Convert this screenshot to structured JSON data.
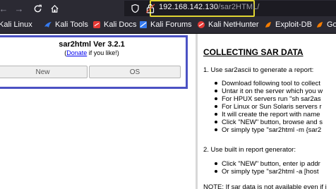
{
  "browser": {
    "url_host": "192.168.142.130",
    "url_path": "/sar2HTML/",
    "bookmarks": [
      {
        "label": "Kali Linux",
        "icon": "kali-icon"
      },
      {
        "label": "Kali Tools",
        "icon": "kali-tools-icon"
      },
      {
        "label": "Kali Docs",
        "icon": "kali-docs-icon"
      },
      {
        "label": "Kali Forums",
        "icon": "kali-forums-icon"
      },
      {
        "label": "Kali NetHunter",
        "icon": "nethunter-icon"
      },
      {
        "label": "Exploit-DB",
        "icon": "exploit-db-icon"
      },
      {
        "label": "Go",
        "icon": "ghdb-icon"
      }
    ]
  },
  "app": {
    "title": "sar2html Ver 3.2.1",
    "donate_prefix": "(",
    "donate_link": "Donate",
    "donate_suffix": " if you like!)",
    "buttons": {
      "new": "New",
      "os": "OS"
    }
  },
  "instructions": {
    "title": "COLLECTING SAR DATA",
    "step1": "1. Use sar2ascii to generate a report:",
    "step1_items": [
      "Download following tool to collect",
      "Untar it on the server which you w",
      "For HPUX servers run \"sh sar2as",
      "For Linux or Sun Solaris servers r",
      "It will create the report with name",
      "Click \"NEW\" button, browse and s",
      "Or simply type \"sar2html -m {sar2"
    ],
    "step2": "2. Use built in report generator:",
    "step2_items": [
      "Click \"NEW\" button, enter ip addr",
      "Or simply type \"sar2html -a [host"
    ],
    "note": "NOTE: If sar data is not available even if i"
  },
  "colors": {
    "chrome_bg": "#2b2a33",
    "url_highlight": "#e0d532",
    "panel_border": "#4b52c4"
  }
}
